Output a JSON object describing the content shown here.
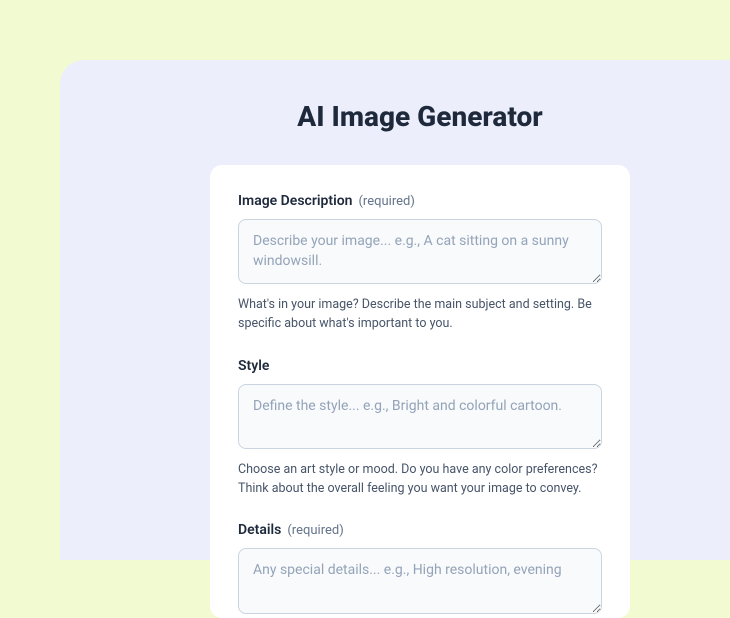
{
  "page": {
    "title": "AI Image Generator"
  },
  "form": {
    "fields": [
      {
        "label": "Image Description",
        "required_tag": "(required)",
        "placeholder": "Describe your image... e.g., A cat sitting on a sunny windowsill.",
        "help": "What's in your image? Describe the main subject and setting. Be specific about what's important to you."
      },
      {
        "label": "Style",
        "required_tag": "",
        "placeholder": "Define the style... e.g., Bright and colorful cartoon.",
        "help": "Choose an art style or mood. Do you have any color preferences? Think about the overall feeling you want your image to convey."
      },
      {
        "label": "Details",
        "required_tag": "(required)",
        "placeholder": "Any special details... e.g., High resolution, evening",
        "help": ""
      }
    ]
  }
}
